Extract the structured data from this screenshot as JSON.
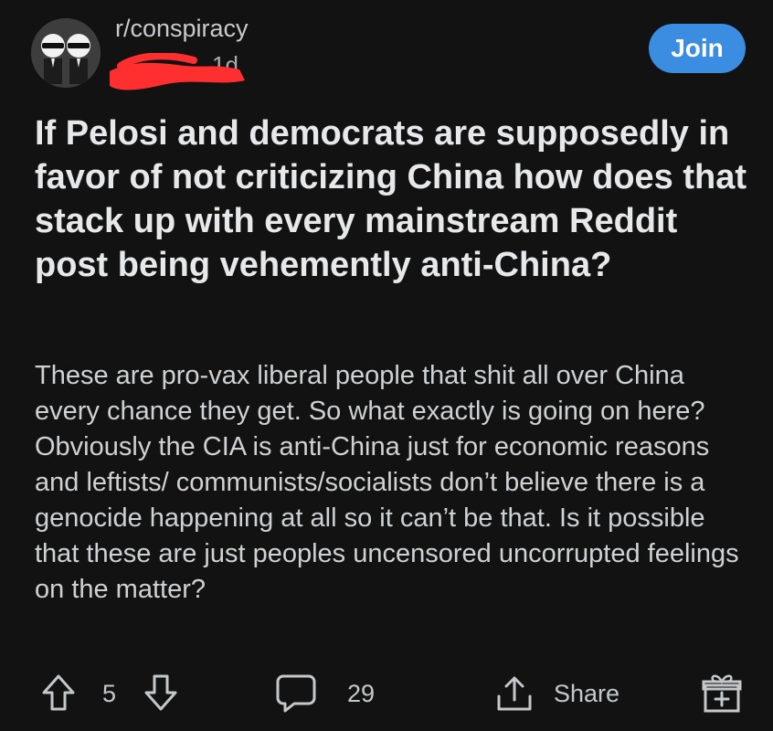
{
  "post": {
    "subreddit": "r/conspiracy",
    "age": "1d",
    "join_label": "Join",
    "title": "If Pelosi and democrats are supposedly in favor of not criticizing China how does that stack up with every mainstream Reddit post being vehemently anti-China?",
    "body": "These are pro-vax liberal people that shit all over China every chance they get. So what exactly is going on here? Obviously the CIA is anti-China just for economic reasons and leftists/ communists/socialists don’t believe there is a genocide happening at all so it can’t be that. Is it possible that these are just peoples uncensored uncorrupted feelings on the matter?"
  },
  "actions": {
    "votes": "5",
    "comments": "29",
    "share_label": "Share"
  },
  "icons": {
    "upvote": "arrow-up-icon",
    "downvote": "arrow-down-icon",
    "comment": "comment-bubble-icon",
    "share": "share-icon",
    "award": "gift-icon"
  },
  "colors": {
    "background": "#121212",
    "join": "#3b8de2",
    "redaction": "#ff2f2f"
  }
}
